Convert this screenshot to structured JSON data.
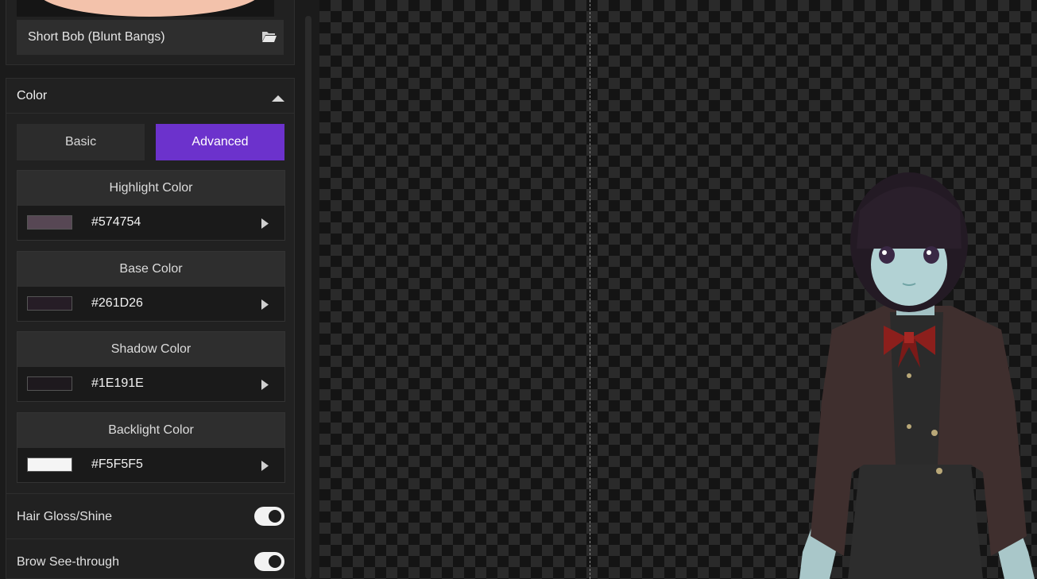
{
  "hair": {
    "selected_name": "Short Bob (Blunt Bangs)",
    "folder_icon": "folder-open-icon"
  },
  "color_section": {
    "title": "Color",
    "collapse_icon": "chevron-up-icon",
    "modes": [
      {
        "label": "Basic",
        "selected": false
      },
      {
        "label": "Advanced",
        "selected": true
      }
    ],
    "accent": "#6C32CC",
    "colors": [
      {
        "label": "Highlight Color",
        "hex": "#574754"
      },
      {
        "label": "Base Color",
        "hex": "#261D26"
      },
      {
        "label": "Shadow Color",
        "hex": "#1E191E"
      },
      {
        "label": "Backlight Color",
        "hex": "#F5F5F5"
      }
    ]
  },
  "toggles": [
    {
      "label": "Hair Gloss/Shine",
      "on": true
    },
    {
      "label": "Brow See-through",
      "on": true
    }
  ]
}
